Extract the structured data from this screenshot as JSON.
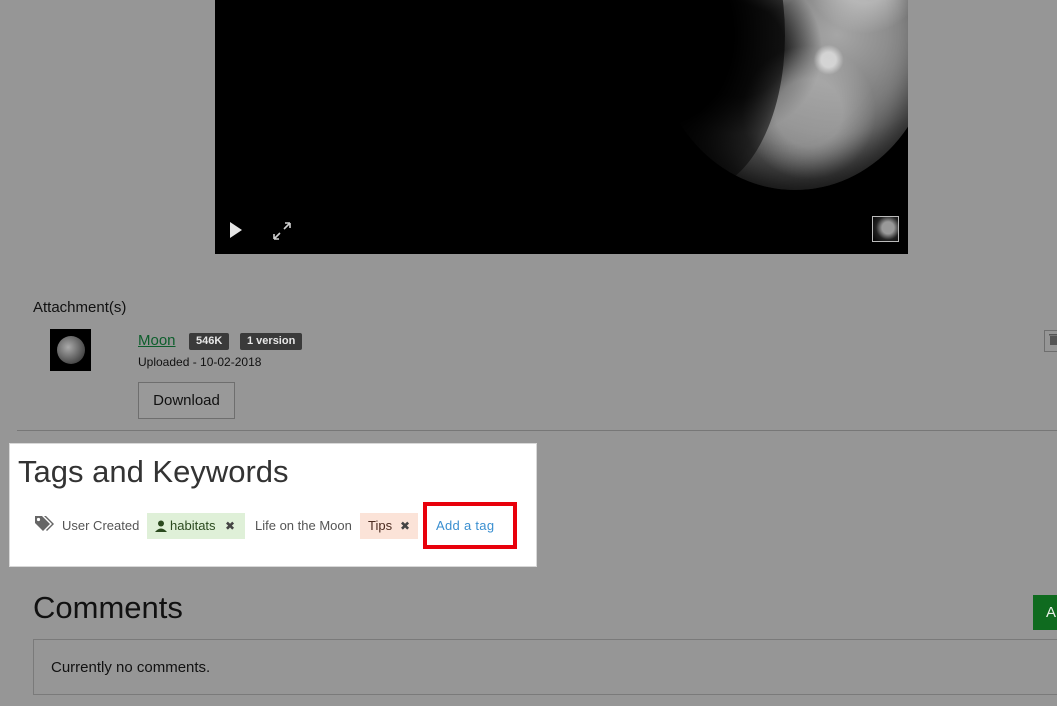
{
  "video": {
    "controls": {
      "play_icon": "play-icon",
      "fullscreen_icon": "fullscreen-expand-icon"
    }
  },
  "attachments": {
    "heading": "Attachment(s)",
    "items": [
      {
        "name": "Moon",
        "size": "546K",
        "versions": "1 version",
        "uploaded": "Uploaded - 10-02-2018",
        "download_label": "Download"
      }
    ]
  },
  "tags": {
    "title": "Tags and Keywords",
    "user_created_label": "User Created",
    "user_tag": "habitats",
    "category_label": "Life on the Moon",
    "category_tag": "Tips",
    "add_tag_label": "Add a tag",
    "highlight_color": "#e8000b"
  },
  "comments": {
    "title": "Comments",
    "add_button_label": "A",
    "empty_message": "Currently no comments."
  }
}
